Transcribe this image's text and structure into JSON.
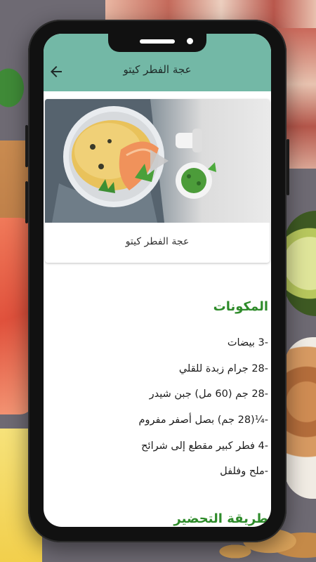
{
  "app": {
    "title": "عجة الفطر كيتو",
    "back_icon": "arrow-left-icon"
  },
  "recipe": {
    "title": "عجة الفطر كيتو",
    "image": "omelette-photo"
  },
  "sections": {
    "ingredients_heading": "المكونات",
    "method_heading": "طريقة التحضير"
  },
  "ingredients": [
    "-3 بيضات",
    "-28 جرام زبدة للقلي",
    "-28 جم (60 مل) جبن شيدر",
    "-¼(28 جم) بصل أصفر مفروم",
    "-4 فطر كبير مقطع إلى شرائح",
    "-ملح وفلفل"
  ],
  "colors": {
    "appbar": "#73b8a6",
    "heading": "#2e8b2a"
  }
}
